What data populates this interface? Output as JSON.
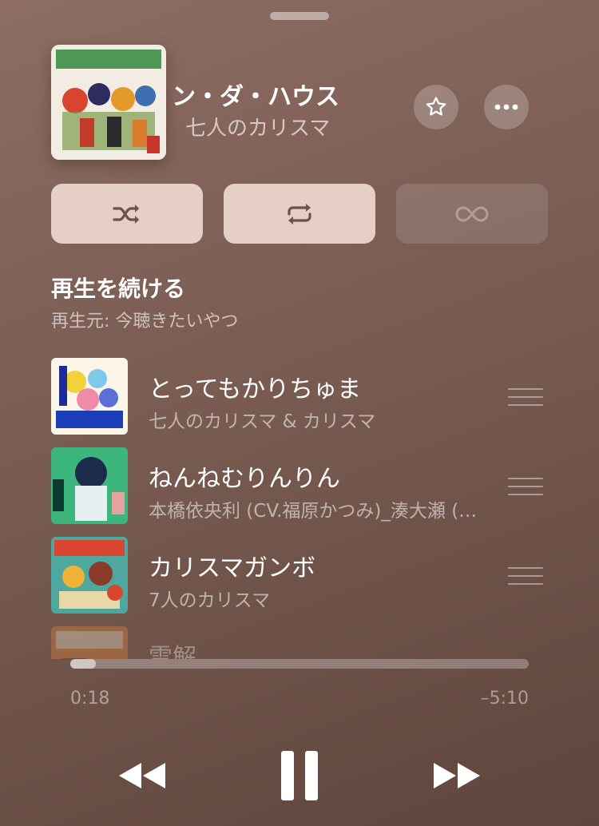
{
  "now_playing": {
    "title": "ン・ダ・ハウス",
    "artist": "七人のカリスマ",
    "elapsed": "0:18",
    "remaining": "–5:10",
    "progress": 0.055
  },
  "icons": {
    "favorite": "star-icon",
    "more": "ellipsis-icon",
    "shuffle": "shuffle-icon",
    "repeat": "repeat-icon",
    "autoplay": "infinity-icon",
    "rewind": "rewind-icon",
    "pause": "pause-icon",
    "forward": "fast-forward-icon"
  },
  "queue": {
    "heading": "再生を続ける",
    "source": "再生元: 今聴きたいやつ",
    "items": [
      {
        "title": "とってもかりちゅま",
        "artist": "七人のカリスマ & カリスマ"
      },
      {
        "title": "ねんねむりんりん",
        "artist": "本橋依央利 (CV.福原かつみ)_湊大瀬 (…"
      },
      {
        "title": "カリスマガンボ",
        "artist": "7人のカリスマ"
      },
      {
        "title": "雪解",
        "artist": ""
      }
    ]
  },
  "colors": {
    "background": "#7d5f55",
    "mode_button_on": "#f4ded4"
  }
}
